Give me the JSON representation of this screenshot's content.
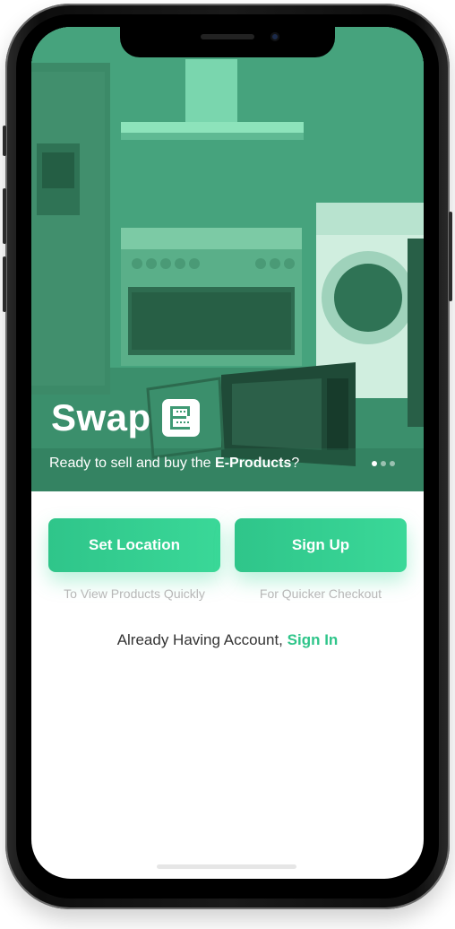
{
  "brand": {
    "name": "Swap",
    "icon": "e-products-logo-icon"
  },
  "hero": {
    "tagline_prefix": "Ready to sell and buy the ",
    "tagline_emphasis": "E-Products",
    "tagline_suffix": "?",
    "carousel": {
      "total": 3,
      "active": 1
    }
  },
  "actions": {
    "set_location": {
      "label": "Set Location",
      "hint": "To View Products Quickly"
    },
    "sign_up": {
      "label": "Sign Up",
      "hint": "For Quicker Checkout"
    }
  },
  "account": {
    "prompt": "Already Having Account, ",
    "link": "Sign In"
  },
  "colors": {
    "accent": "#3ad898",
    "accent_dark": "#2fc58a",
    "hero_tint": "#3f9a74"
  }
}
